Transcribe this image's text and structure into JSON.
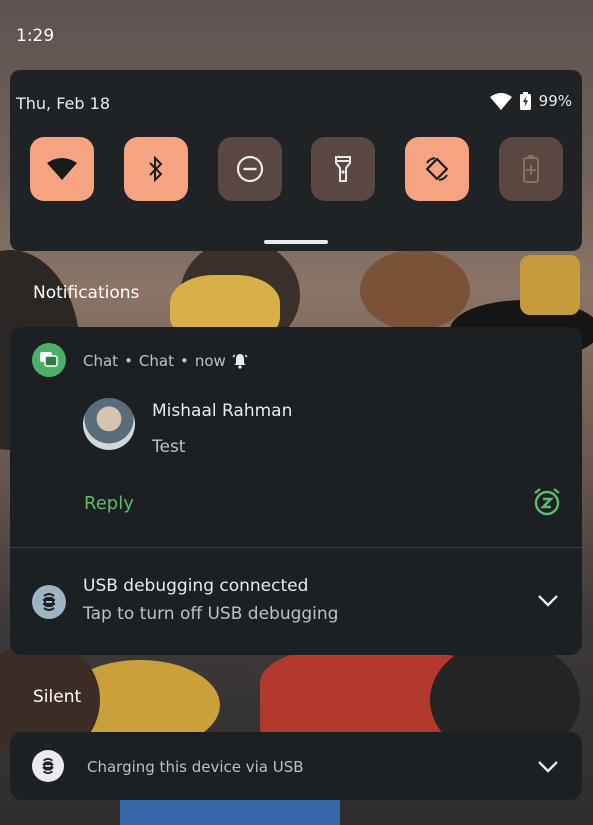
{
  "status_bar": {
    "time": "1:29"
  },
  "quick_settings": {
    "date": "Thu, Feb 18",
    "battery_percent": "99%",
    "tiles": [
      {
        "name": "wifi",
        "icon": "wifi-icon",
        "state": "on"
      },
      {
        "name": "bluetooth",
        "icon": "bluetooth-icon",
        "state": "on"
      },
      {
        "name": "do-not-disturb",
        "icon": "dnd-icon",
        "state": "off"
      },
      {
        "name": "flashlight",
        "icon": "flashlight-icon",
        "state": "off"
      },
      {
        "name": "auto-rotate",
        "icon": "rotate-icon",
        "state": "on"
      },
      {
        "name": "battery-saver",
        "icon": "battery-saver-icon",
        "state": "off"
      }
    ]
  },
  "sections": {
    "notifications": "Notifications",
    "silent": "Silent"
  },
  "chat_notification": {
    "app": "Chat",
    "channel": "Chat",
    "time": "now",
    "sender": "Mishaal Rahman",
    "message": "Test",
    "reply_label": "Reply"
  },
  "usb_notification": {
    "title": "USB debugging connected",
    "subtitle": "Tap to turn off USB debugging"
  },
  "charging_notification": {
    "text": "Charging this device via USB"
  },
  "colors": {
    "tile_on": "#f6a382",
    "tile_off": "#5b4741",
    "card_bg": "#1d2023",
    "accent_green": "#5dbb6f"
  }
}
